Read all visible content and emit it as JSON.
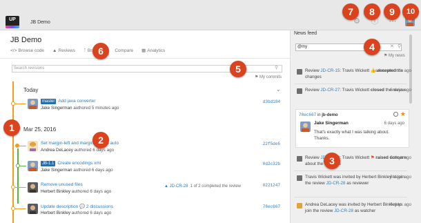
{
  "header": {
    "logo_text": "UP",
    "project": "JB Demo",
    "icons": [
      "settings-icon",
      "help-icon",
      "apps-grid-icon",
      "user-avatar"
    ]
  },
  "callouts": [
    "1",
    "2",
    "3",
    "4",
    "5",
    "6",
    "7",
    "8",
    "9",
    "10"
  ],
  "main": {
    "title": "JB Demo",
    "nav": [
      "Browse code",
      "Reviews",
      "Branches",
      "Compare",
      "Analytics"
    ],
    "search_placeholder": "Search revisions",
    "my_commits": "My commits",
    "today": "Today",
    "date_header": "Mar 25, 2016",
    "commits": [
      {
        "branch": "master",
        "title": "Add java converter",
        "author": "Jake Singerman",
        "meta": "authored 5 minutes ago",
        "hash": "d3bd184"
      },
      {
        "title": "Set margin-left and margin-right to auto",
        "author": "Andrea DeLacey",
        "meta": "authored 6 days ago",
        "hash": "22f5de6"
      },
      {
        "branch": "JB-1.1",
        "title": "Create encodings xml",
        "author": "Jake Singerman",
        "meta": "authored 6 days ago",
        "hash": "0d2c32b"
      },
      {
        "title": "Remove unused files",
        "author": "Herbert Binkley",
        "meta": "authored 6 days ago",
        "hash": "0221247",
        "review": "JD-CR-28",
        "review_note": "1 of 2 completed the review"
      },
      {
        "title": "Update description",
        "comments": "2 discussions",
        "author": "Herbert Binkley",
        "meta": "authored 6 days ago",
        "hash": "78ec667"
      }
    ]
  },
  "news": {
    "title": "News feed",
    "search_value": "@my",
    "my_news": "My news",
    "items": [
      {
        "pre": "Review ",
        "link": "JD-CR-15",
        "mid": ": Travis Wickett ",
        "bold": "accepted",
        "post": " the changes",
        "time": "a few seconds ago"
      },
      {
        "pre": "Review ",
        "link": "JD-CR-27",
        "mid": ": Travis Wickett ",
        "bold": "closed",
        "post": " the review",
        "time": "6 days ago"
      },
      {
        "pre": "Review ",
        "link": "JD-CR-29",
        "mid": ": Travis Wickett ",
        "bold": "raised concern",
        "post": " about the changes",
        "time": "6 days ago"
      },
      {
        "pre": "Travis Wickett was invited by Herbert Binkley to join the review ",
        "link": "JD-CR-28",
        "post": " as reviewer",
        "time": "6 days ago"
      },
      {
        "pre": "Andrea DeLacey was invited by Herbert Binkley to join the review ",
        "link": "JD-CR-28",
        "post": " as watcher",
        "time": "6 days ago"
      }
    ],
    "card": {
      "hash": "78ec667",
      "in": " in ",
      "repo": "jb-demo",
      "author": "Jake Singerman",
      "time": "6 days ago",
      "message": "That's exactly what I was talking about. Thanks."
    }
  }
}
